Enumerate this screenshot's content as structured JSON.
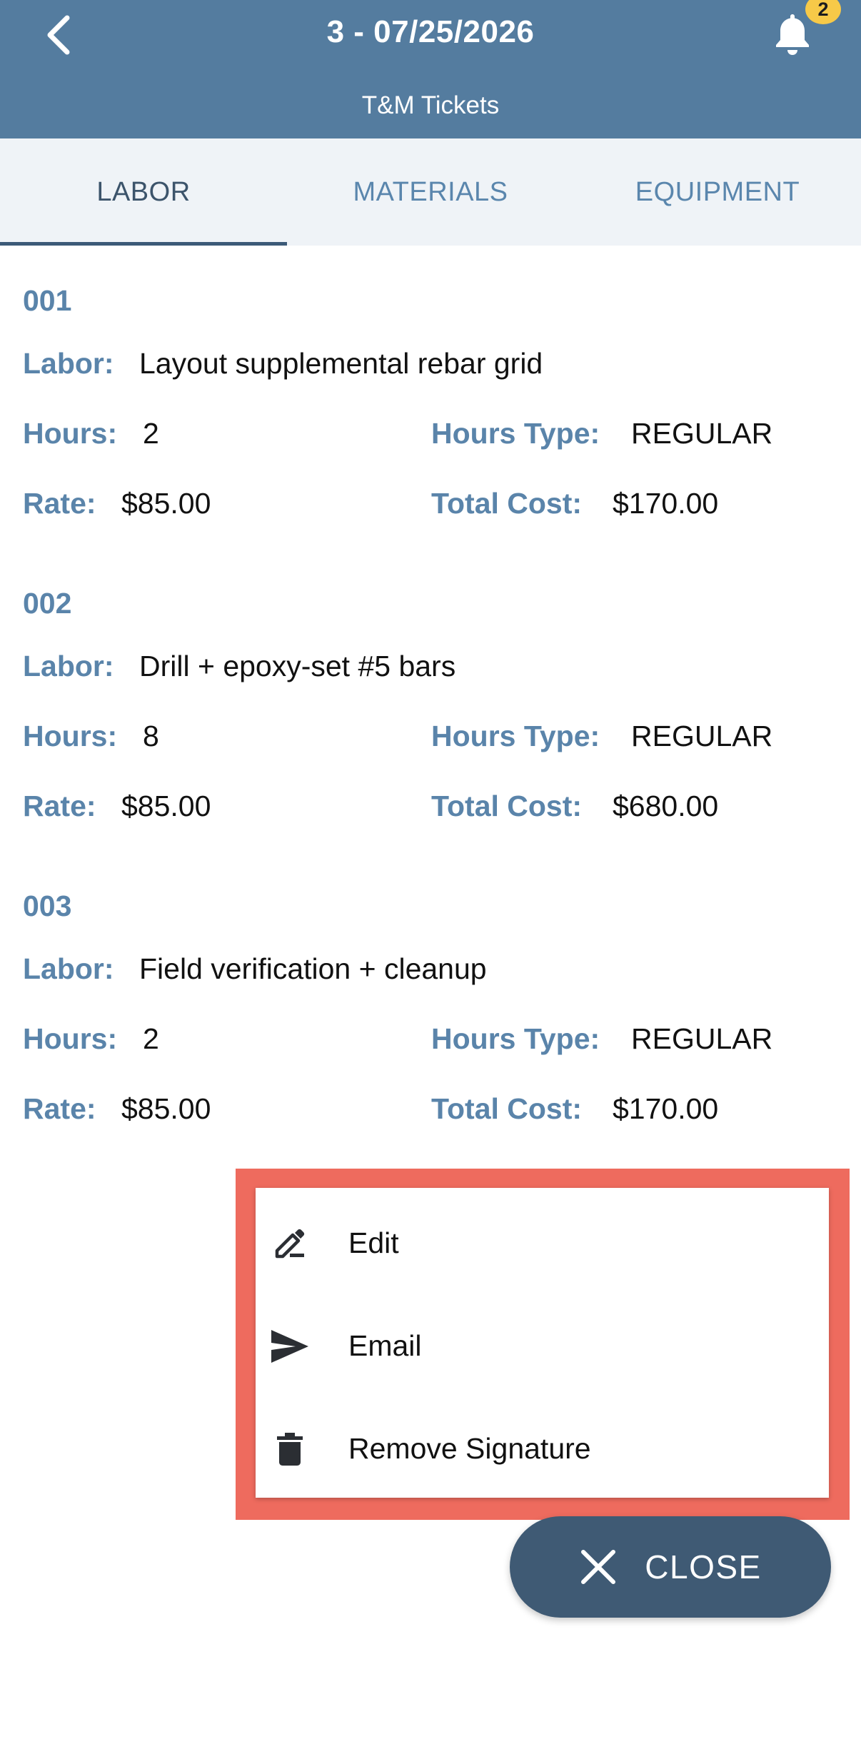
{
  "header": {
    "title": "3 - 07/25/2026",
    "subtitle": "T&M Tickets",
    "notification_count": "2",
    "back_icon": "chevron-left-icon",
    "bell_icon": "bell-icon",
    "background_color": "#547c9f",
    "badge_color": "#f7c948"
  },
  "tabs": [
    {
      "label": "LABOR",
      "active": true
    },
    {
      "label": "MATERIALS",
      "active": false
    },
    {
      "label": "EQUIPMENT",
      "active": false
    }
  ],
  "labels": {
    "labor": "Labor:",
    "hours": "Hours:",
    "hours_type": "Hours Type:",
    "rate": "Rate:",
    "total_cost": "Total Cost:"
  },
  "entries": [
    {
      "number": "001",
      "labor": "Layout supplemental rebar grid",
      "hours": "2",
      "hours_type": "REGULAR",
      "rate": "$85.00",
      "total_cost": "$170.00"
    },
    {
      "number": "002",
      "labor": "Drill + epoxy-set #5 bars",
      "hours": "8",
      "hours_type": "REGULAR",
      "rate": "$85.00",
      "total_cost": "$680.00"
    },
    {
      "number": "003",
      "labor": "Field verification + cleanup",
      "hours": "2",
      "hours_type": "REGULAR",
      "rate": "$85.00",
      "total_cost": "$170.00"
    }
  ],
  "menu": {
    "items": [
      {
        "label": "Edit",
        "icon": "pencil-edit-icon"
      },
      {
        "label": "Email",
        "icon": "send-icon"
      },
      {
        "label": "Remove Signature",
        "icon": "trash-icon"
      }
    ],
    "highlight_color": "#ee6b5e"
  },
  "close_button": {
    "label": "CLOSE",
    "icon": "close-icon",
    "color": "#3f5a74"
  },
  "colors": {
    "label_blue": "#5a84aa",
    "tab_bar_bg": "#eff3f7",
    "tab_indicator": "#3c5a78"
  }
}
